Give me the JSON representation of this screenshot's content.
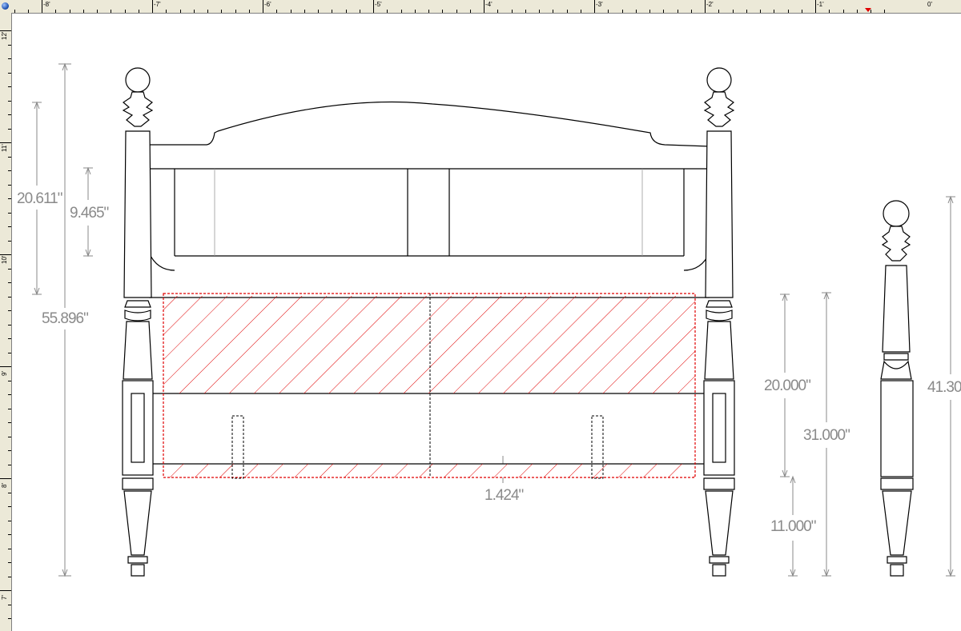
{
  "ruler": {
    "top_labels": [
      "-8'",
      "-7'",
      "-6'",
      "-5'",
      "-4'",
      "-3'",
      "-2'",
      "-1'",
      "0'"
    ],
    "left_labels": [
      "12'",
      "11'",
      "10'",
      "9'",
      "8'",
      "7'"
    ]
  },
  "dimensions": {
    "overall_height": "55.896\"",
    "headboard_upper": "20.611\"",
    "rail_panel": "9.465\"",
    "rail_offset": "1.424\"",
    "footboard_panel": "20.000\"",
    "footboard_total": "31.000\"",
    "leg_clearance": "11.000\"",
    "side_post_height": "41.30"
  },
  "colors": {
    "line": "#000000",
    "dimension": "#8a8a8a",
    "hatch": "#e00000",
    "ruler_bg": "#ece9d8",
    "canvas": "#ffffff"
  },
  "icons": {
    "corner": "globe-origin-icon",
    "marker": "ruler-position-marker-icon"
  }
}
